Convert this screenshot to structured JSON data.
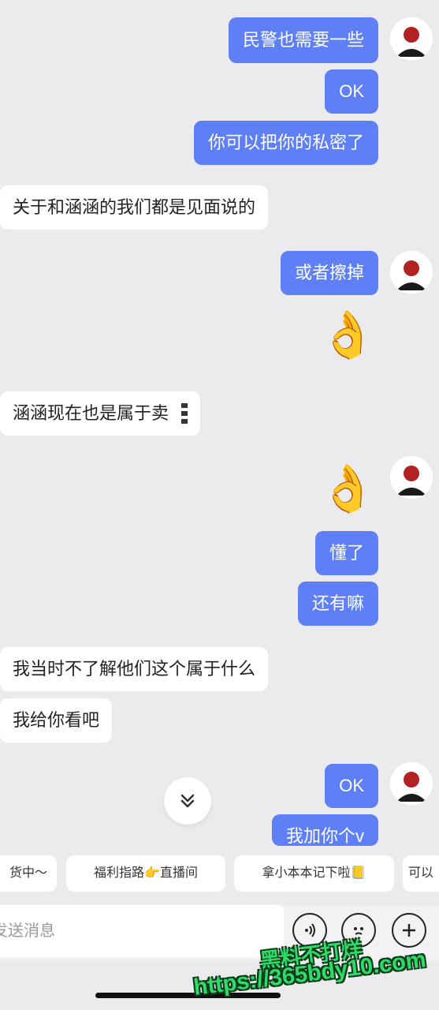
{
  "messages": {
    "m1": "民警也需要一些",
    "m2": "OK",
    "m3": "你可以把你的私密了",
    "m4": "关于和涵涵的我们都是见面说的",
    "m5": "或者擦掉",
    "m6": "👌",
    "m7": "涵涵现在也是属于卖",
    "m8": "👌",
    "m9": "懂了",
    "m10": "还有嘛",
    "m11": "我当时不了解他们这个属于什么",
    "m12": "我给你看吧",
    "m13": "OK",
    "m14": "我加你个v"
  },
  "chips": [
    "货中～",
    "福利指路👉直播间",
    "拿小本本记下啦📒",
    "可以"
  ],
  "input": {
    "placeholder": "发送消息"
  },
  "watermark": {
    "line1": "黑料不打烊",
    "line2": "https://365bdy10.com"
  },
  "colors": {
    "outgoing_bubble": "#5e7ff5",
    "incoming_bubble": "#ffffff",
    "background": "#ebebed",
    "watermark": "#2fd96a"
  }
}
